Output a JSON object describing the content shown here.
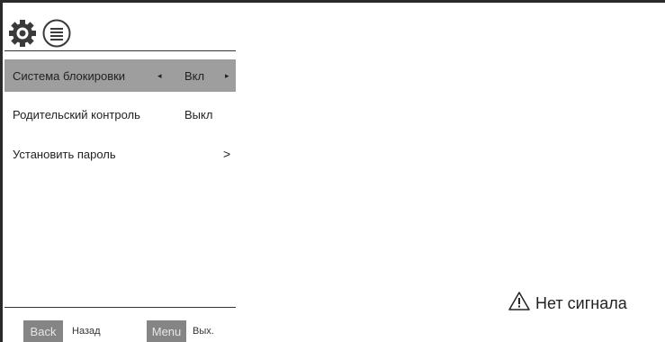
{
  "menu": {
    "items": [
      {
        "label": "Система блокировки",
        "value": "Вкл",
        "left_arrow": "◂",
        "right_arrow": "▸",
        "selected": true
      },
      {
        "label": "Родительский контроль",
        "value": "Выкл"
      },
      {
        "label": "Установить пароль",
        "chevron": ">"
      }
    ]
  },
  "footer": {
    "back_key": "Back",
    "back_label": "Назад",
    "menu_key": "Menu",
    "menu_label": "Вых."
  },
  "status": {
    "no_signal": "Нет сигнала"
  },
  "icons": {
    "settings": "gear-icon",
    "menu": "menu-list-icon",
    "warning": "warning-icon"
  },
  "colors": {
    "selected_row": "#9e9e9e",
    "key_bg": "#858585",
    "frame": "#2a2a2a"
  }
}
